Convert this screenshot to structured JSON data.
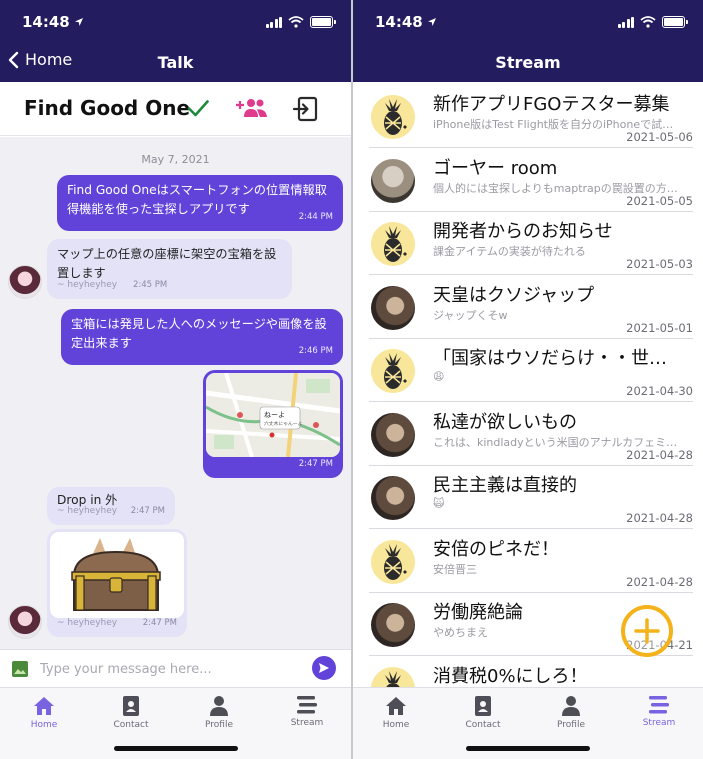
{
  "status": {
    "time": "14:48"
  },
  "talk": {
    "nav_back": "Home",
    "nav_title": "Talk",
    "title": "Find Good One",
    "date_separator": "May 7, 2021",
    "messages": [
      {
        "text": "Find Good Oneはスマートフォンの位置情報取得機能を使った宝探しアプリです",
        "time": "2:44 PM"
      },
      {
        "text": "マップ上の任意の座標に架空の宝箱を設置します",
        "sender": "~ heyheyhey",
        "time": "2:45 PM"
      },
      {
        "text": "宝箱には発見した人へのメッセージや画像を設定出来ます",
        "time": "2:46 PM"
      },
      {
        "map_label": "ねーよ",
        "map_sub": "六丈木にゃんーよ",
        "time": "2:47 PM"
      },
      {
        "text": "Drop in 外",
        "sender": "~ heyheyhey",
        "time": "2:47 PM"
      },
      {
        "sender": "~ heyheyhey",
        "time": "2:47 PM"
      }
    ],
    "input_placeholder": "Type your message here..."
  },
  "stream": {
    "nav_title": "Stream",
    "items": [
      {
        "title": "新作アプリFGOテスター募集",
        "sub": "iPhone版はTest Flight版を自分のiPhoneで試…",
        "date": "2021-05-06",
        "avatar": "pineapple"
      },
      {
        "title": "ゴーヤー room",
        "sub": "個人的には宝探しよりもmaptrapの罠設置の方…",
        "date": "2021-05-05",
        "avatar": "statue"
      },
      {
        "title": "開発者からのお知らせ",
        "sub": "課金アイテムの実装が待たれる",
        "date": "2021-05-03",
        "avatar": "pineapple"
      },
      {
        "title": "天皇はクソジャップ",
        "sub": "ジャップくそw",
        "date": "2021-05-01",
        "avatar": "cat"
      },
      {
        "title": "「国家はウソだらけ・・世…",
        "sub": "😩",
        "date": "2021-04-30",
        "avatar": "pineapple"
      },
      {
        "title": "私達が欲しいもの",
        "sub": "これは、kindladyという米国のアナルカフェミ…",
        "date": "2021-04-28",
        "avatar": "cat"
      },
      {
        "title": "民主主義は直接的",
        "sub": "🙀",
        "date": "2021-04-28",
        "avatar": "cat"
      },
      {
        "title": "安倍のピネだ！",
        "sub": "安倍晋三",
        "date": "2021-04-28",
        "avatar": "pineapple"
      },
      {
        "title": "労働廃絶論",
        "sub": "やめちまえ",
        "date": "2021-04-21",
        "avatar": "cat"
      },
      {
        "title": "消費税0%にしろ！",
        "sub": "",
        "date": "",
        "avatar": "pineapple"
      }
    ]
  },
  "tabs": [
    "Home",
    "Contact",
    "Profile",
    "Stream"
  ],
  "colors": {
    "nav": "#231c5e",
    "accent": "#6143d9",
    "green": "#1f8a3b",
    "pink": "#e03a8d",
    "fab": "#f4b21b"
  }
}
